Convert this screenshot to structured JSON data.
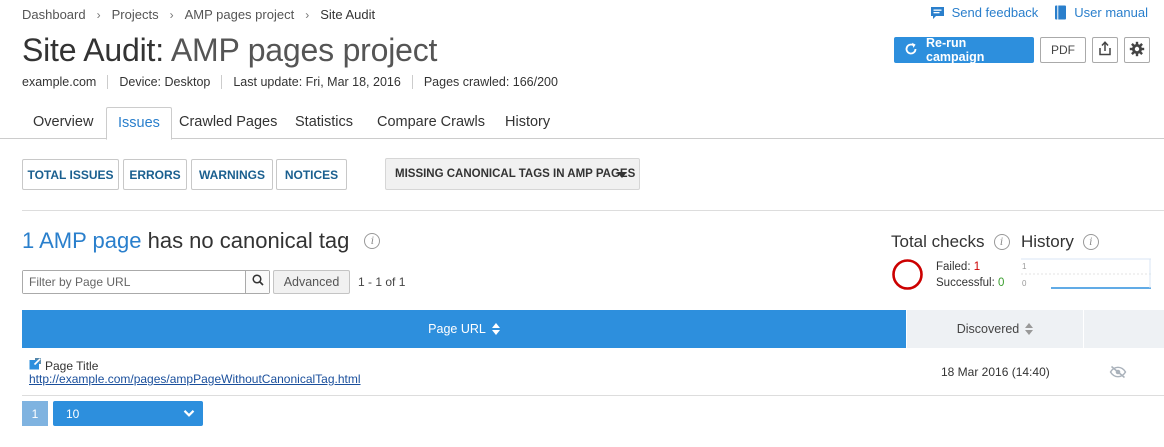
{
  "breadcrumb": [
    {
      "label": "Dashboard"
    },
    {
      "label": "Projects"
    },
    {
      "label": "AMP pages project"
    },
    {
      "label": "Site Audit"
    }
  ],
  "top_links": {
    "feedback": "Send feedback",
    "manual": "User manual"
  },
  "title": {
    "prefix": "Site Audit:",
    "project": "AMP pages project"
  },
  "meta": {
    "domain": "example.com",
    "device": "Device: Desktop",
    "last_update": "Last update: Fri, Mar 18, 2016",
    "pages_crawled": "Pages crawled: 166/200"
  },
  "actions": {
    "rerun": "Re-run campaign",
    "pdf": "PDF"
  },
  "tabs": [
    {
      "label": "Overview",
      "active": false
    },
    {
      "label": "Issues",
      "active": true
    },
    {
      "label": "Crawled Pages",
      "active": false
    },
    {
      "label": "Statistics",
      "active": false
    },
    {
      "label": "Compare Crawls",
      "active": false
    },
    {
      "label": "History",
      "active": false
    }
  ],
  "filters": {
    "total": "TOTAL ISSUES",
    "errors": "ERRORS",
    "warnings": "WARNINGS",
    "notices": "NOTICES",
    "issue_select": "MISSING CANONICAL TAGS IN AMP PAGES"
  },
  "issue": {
    "highlight": "1 AMP page",
    "rest": "has no canonical tag"
  },
  "search": {
    "placeholder": "Filter by Page URL",
    "value": "",
    "advanced": "Advanced",
    "range": "1 - 1 of 1"
  },
  "total_checks": {
    "heading": "Total checks",
    "failed_label": "Failed:",
    "failed": 1,
    "successful_label": "Successful:",
    "successful": 0
  },
  "history": {
    "heading": "History",
    "y_top": "1",
    "y_bottom": "0"
  },
  "table": {
    "columns": {
      "url": "Page URL",
      "discovered": "Discovered"
    },
    "rows": [
      {
        "title": "Page Title",
        "url": "http://example.com/pages/ampPageWithoutCanonicalTag.html",
        "discovered": "18 Mar 2016 (14:40)"
      }
    ]
  },
  "pagination": {
    "page": "1",
    "per_page": "10"
  },
  "colors": {
    "accent": "#2d8fdd",
    "link": "#2a7fcc",
    "failed": "#cc0000",
    "successful": "#3a9e2e"
  },
  "icons": [
    "feedback-icon",
    "manual-icon",
    "refresh-icon",
    "share-icon",
    "gear-icon",
    "info-icon",
    "search-icon",
    "external-link-icon",
    "hide-icon",
    "chevron-down-icon"
  ]
}
